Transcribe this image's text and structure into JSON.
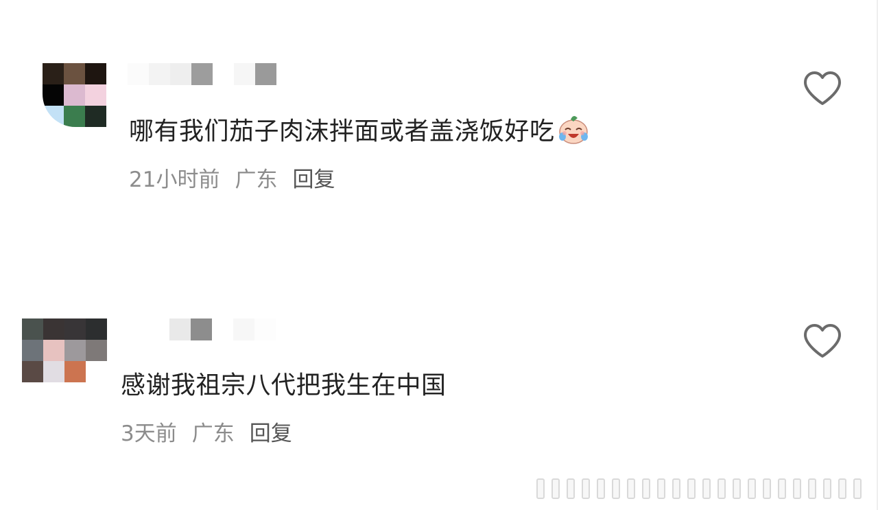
{
  "comments": [
    {
      "text": "哪有我们茄子肉沫拌面或者盖浇饭好吃",
      "time": "21小时前",
      "location": "广东",
      "reply": "回复",
      "avatar_colors": [
        "#2a2018",
        "#6b5240",
        "#1e1510",
        "#050505",
        "#dcbad0",
        "#f3d2df",
        "#c3e1f6",
        "#3b7d4e",
        "#1f2b24"
      ],
      "name_colors": [
        "#fbfbfb",
        "#f3f3f3",
        "#eeeeee",
        "#9d9d9d",
        "#ffffff",
        "#f6f6f6",
        "#9a9a9a"
      ],
      "emoji": "laughing-crying-baby-emoji"
    },
    {
      "text": "感谢我祖宗八代把我生在中国",
      "time": "3天前",
      "location": "广东",
      "reply": "回复",
      "avatar_colors": [
        "#4a524e",
        "#3a3434",
        "#383537",
        "#2c2e2f",
        "#6d7379",
        "#e7c2c0",
        "#9d999c",
        "#7e7978",
        "#5a4a45",
        "#e1dde3",
        "#cc7450",
        "#ffffff"
      ],
      "name_colors": [
        "#ffffff",
        "#e9e9e9",
        "#8d8d8d",
        "#ffffff",
        "#f7f7f7",
        "#fdfdfd"
      ]
    }
  ],
  "icons": {
    "like": "heart-outline-icon",
    "emoji": "laughing-crying-baby-emoji"
  },
  "colors": {
    "text": "#222222",
    "meta": "#8c8c8c",
    "reply": "#555555",
    "heart_stroke": "#6b6b6b"
  }
}
